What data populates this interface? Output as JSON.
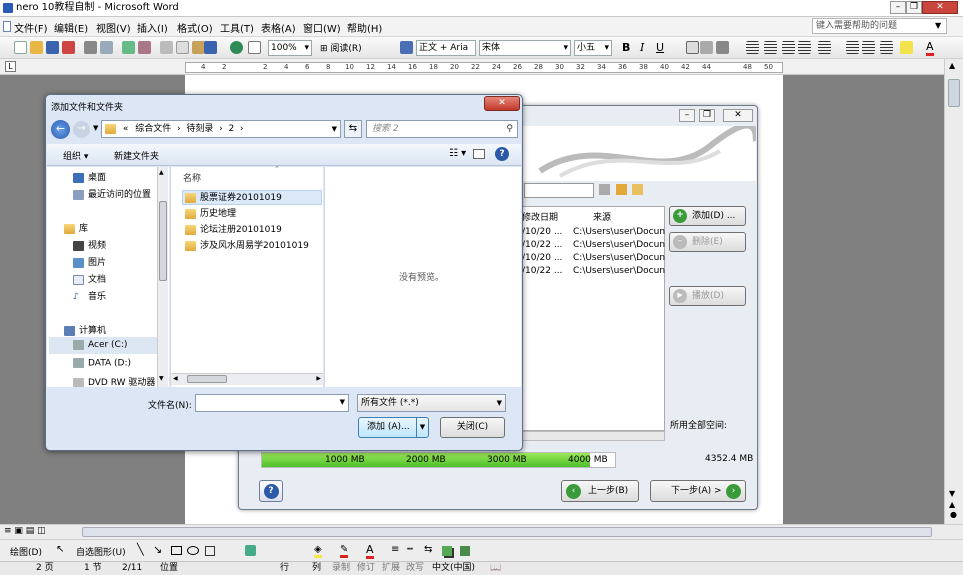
{
  "window": {
    "title": "nero 10教程自制 - Microsoft Word"
  },
  "menu": [
    "文件(F)",
    "编辑(E)",
    "视图(V)",
    "插入(I)",
    "格式(O)",
    "工具(T)",
    "表格(A)",
    "窗口(W)",
    "帮助(H)"
  ],
  "help_search": {
    "placeholder": "键入需要帮助的问题"
  },
  "toolbar": {
    "zoom": "100%",
    "read_label": "阅读(R)",
    "style": "正文 + Aria",
    "font": "宋体",
    "size": "小五",
    "bold": "B",
    "italic": "I",
    "underline": "U",
    "font_color_label": "A"
  },
  "ruler": {
    "ticks": [
      "4",
      "2",
      "2",
      "4",
      "6",
      "8",
      "10",
      "12",
      "14",
      "16",
      "18",
      "20",
      "22",
      "24",
      "26",
      "28",
      "30",
      "32",
      "34",
      "36",
      "38",
      "40",
      "42",
      "44",
      "48",
      "50"
    ]
  },
  "drawbar": {
    "draw_label": "绘图(D)",
    "autoshape_label": "自选图形(U)"
  },
  "statusbar": {
    "page": "2 页",
    "section": "1 节",
    "pages": "2/11",
    "position": "位置",
    "line": "行",
    "col": "列",
    "rec": "录制",
    "trk": "修订",
    "ext": "扩展",
    "ovr": "改写",
    "lang": "中文(中国)"
  },
  "dialog": {
    "title": "添加文件和文件夹",
    "breadcrumb": [
      "«",
      "综合文件",
      "待刻录",
      "2"
    ],
    "search_placeholder": "搜索 2",
    "organize": "组织",
    "new_folder": "新建文件夹",
    "nav": [
      {
        "label": "桌面",
        "icon": "desktop-icon"
      },
      {
        "label": "最近访问的位置",
        "icon": "recent-places-icon"
      },
      {
        "label": "库",
        "icon": "library-icon"
      },
      {
        "label": "视频",
        "icon": "video-icon"
      },
      {
        "label": "图片",
        "icon": "pictures-icon"
      },
      {
        "label": "文档",
        "icon": "documents-icon"
      },
      {
        "label": "音乐",
        "icon": "music-icon"
      },
      {
        "label": "计算机",
        "icon": "computer-icon"
      },
      {
        "label": "Acer (C:)",
        "icon": "drive-icon"
      },
      {
        "label": "DATA (D:)",
        "icon": "drive-icon"
      },
      {
        "label": "DVD RW 驱动器",
        "icon": "dvd-drive-icon"
      }
    ],
    "column_name": "名称",
    "files": [
      "股票证券20101019",
      "历史地理",
      "论坛注册20101019",
      "涉及风水周易学20101019"
    ],
    "no_preview": "没有预览。",
    "filename_label": "文件名(N):",
    "filename_value": "",
    "filetype": "所有文件 (*.*)",
    "add_button": "添加 (A)...",
    "close_button": "关闭(C)"
  },
  "nero": {
    "col_date": "修改日期",
    "col_source": "来源",
    "rows": [
      {
        "date": "/10/20 ...",
        "source": "C:\\Users\\user\\Docun"
      },
      {
        "date": "/10/22 ...",
        "source": "C:\\Users\\user\\Docun"
      },
      {
        "date": "/10/20 ...",
        "source": "C:\\Users\\user\\Docun"
      },
      {
        "date": "/10/22 ...",
        "source": "C:\\Users\\user\\Docun"
      }
    ],
    "add_button": "添加(D) ...",
    "delete_button": "删除(E)",
    "play_button": "播放(D)",
    "total_space_label": "所用全部空间:",
    "total_space_value": "4352.4 MB",
    "capacity_ticks": [
      "1000 MB",
      "2000 MB",
      "3000 MB",
      "4000 MB"
    ],
    "capacity_fill": 0.93,
    "back_button": "上一步(B)",
    "next_button": "下一步(A) >"
  }
}
